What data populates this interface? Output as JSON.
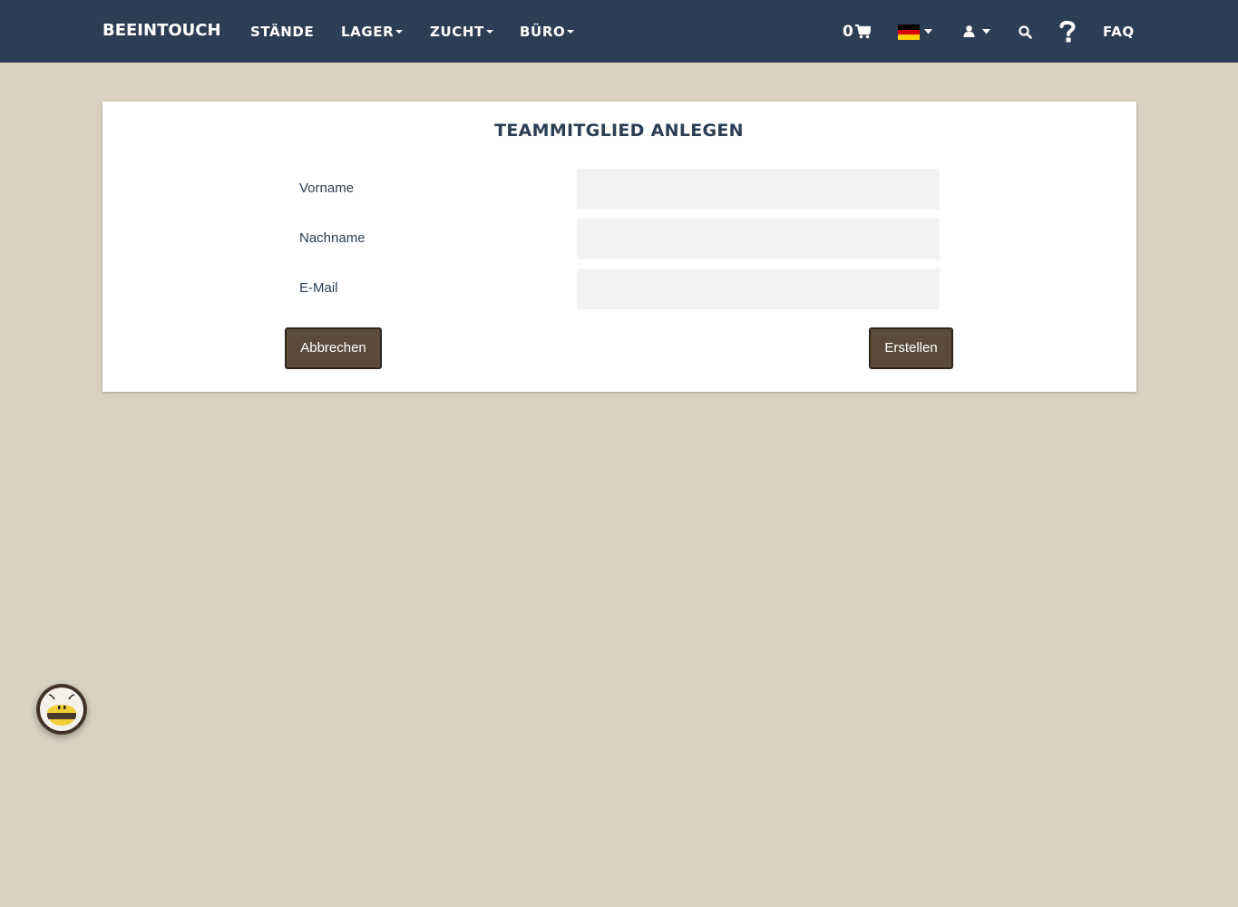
{
  "navbar": {
    "brand": "BEEINTOUCH",
    "items": [
      {
        "label": "STÄNDE",
        "dropdown": false
      },
      {
        "label": "LAGER",
        "dropdown": true
      },
      {
        "label": "ZUCHT",
        "dropdown": true
      },
      {
        "label": "BÜRO",
        "dropdown": true
      }
    ],
    "cart_count": "0",
    "faq_label": "FAQ",
    "icons": [
      "shopping-cart-icon",
      "german-flag-icon",
      "user-icon",
      "search-icon",
      "question-mark-icon"
    ]
  },
  "form": {
    "title": "TEAMMITGLIED ANLEGEN",
    "fields": [
      {
        "label": "Vorname",
        "value": "",
        "placeholder": ""
      },
      {
        "label": "Nachname",
        "value": "",
        "placeholder": ""
      },
      {
        "label": "E-Mail",
        "value": "",
        "placeholder": ""
      }
    ],
    "cancel_label": "Abbrechen",
    "submit_label": "Erstellen"
  },
  "colors": {
    "navbar_bg": "#2c3e54",
    "page_bg": "#d9d2c1",
    "button_bg": "#5c4a3a",
    "input_bg": "#f2f2f2"
  }
}
